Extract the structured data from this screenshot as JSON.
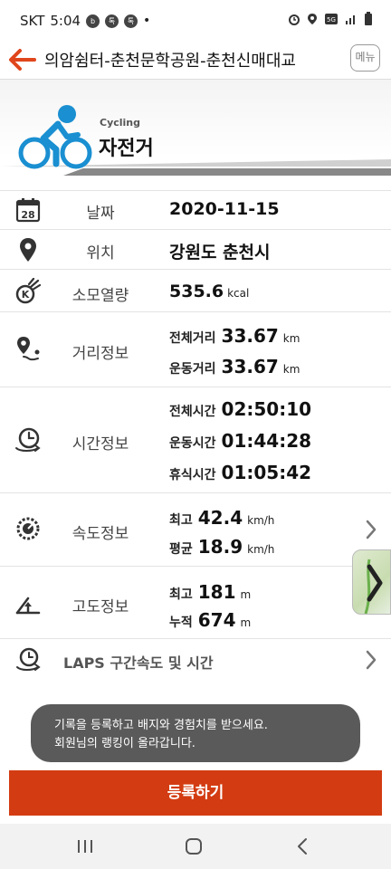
{
  "status_bar": {
    "carrier": "SKT",
    "time": "5:04"
  },
  "header": {
    "title": "의암쉼터-춘천문학공원-춘천신매대교",
    "menu_label": "메뉴"
  },
  "activity": {
    "sub": "Cycling",
    "name": "자전거"
  },
  "rows": {
    "date": {
      "label": "날짜",
      "value": "2020-11-15"
    },
    "location": {
      "label": "위치",
      "value": "강원도 춘천시"
    },
    "calories": {
      "label": "소모열량",
      "value": "535.6",
      "unit": "kcal"
    },
    "distance": {
      "label": "거리정보",
      "total_label": "전체거리",
      "total_value": "33.67",
      "total_unit": "km",
      "exercise_label": "운동거리",
      "exercise_value": "33.67",
      "exercise_unit": "km"
    },
    "time": {
      "label": "시간정보",
      "total_label": "전체시간",
      "total_value": "02:50:10",
      "exercise_label": "운동시간",
      "exercise_value": "01:44:28",
      "rest_label": "휴식시간",
      "rest_value": "01:05:42"
    },
    "speed": {
      "label": "속도정보",
      "max_label": "최고",
      "max_value": "42.4",
      "max_unit": "km/h",
      "avg_label": "평균",
      "avg_value": "18.9",
      "avg_unit": "km/h"
    },
    "altitude": {
      "label": "고도정보",
      "max_label": "최고",
      "max_value": "181",
      "max_unit": "m",
      "cum_label": "누적",
      "cum_value": "674",
      "cum_unit": "m"
    },
    "laps": {
      "label": "LAPS 구간속도 및 시간"
    }
  },
  "toast": {
    "line1": "기록을 등록하고 배지와 경험치를 받으세요.",
    "line2": "회원님의 랭킹이 올라갑니다."
  },
  "register": {
    "label": "등록하기"
  },
  "colors": {
    "accent": "#d33c12",
    "icon_blue": "#1a8fd1",
    "back_arrow": "#e0461c"
  },
  "icons": {
    "back": "arrow-left-icon",
    "cyclist": "cyclist-icon",
    "calendar": "calendar-icon",
    "pin": "location-pin-icon",
    "calories": "flame-k-icon",
    "route": "route-pin-icon",
    "clock": "clock-icon",
    "speed": "speedometer-icon",
    "altitude": "altitude-icon",
    "laps": "laps-clock-icon",
    "chevron": "chevron-right-icon"
  }
}
